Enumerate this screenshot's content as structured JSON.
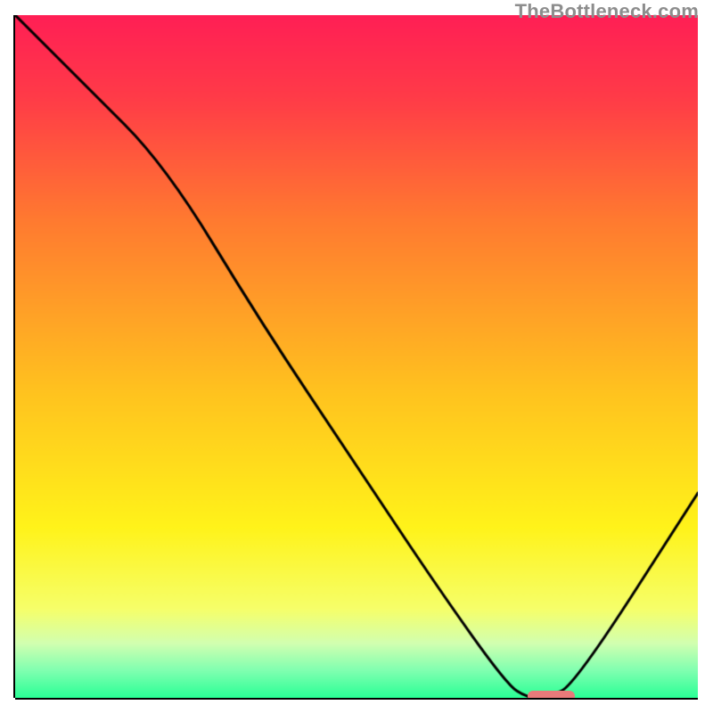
{
  "watermark": "TheBottleneck.com",
  "chart_data": {
    "type": "line",
    "title": "",
    "xlabel": "",
    "ylabel": "",
    "xlim": [
      0,
      100
    ],
    "ylim": [
      0,
      100
    ],
    "background": {
      "type": "vertical-gradient",
      "stops": [
        {
          "pos": 0.0,
          "color": "#ff1f55"
        },
        {
          "pos": 0.12,
          "color": "#ff3b48"
        },
        {
          "pos": 0.3,
          "color": "#ff7a30"
        },
        {
          "pos": 0.55,
          "color": "#ffc21f"
        },
        {
          "pos": 0.75,
          "color": "#fff31a"
        },
        {
          "pos": 0.87,
          "color": "#f6ff6a"
        },
        {
          "pos": 0.92,
          "color": "#d2ffb0"
        },
        {
          "pos": 0.96,
          "color": "#80ffb0"
        },
        {
          "pos": 1.0,
          "color": "#2aff96"
        }
      ]
    },
    "series": [
      {
        "name": "bottleneck-curve",
        "x": [
          0,
          10,
          22,
          36,
          50,
          62,
          72,
          75,
          78,
          82,
          100
        ],
        "y": [
          100,
          90,
          78,
          55,
          34,
          16,
          2,
          0,
          0,
          2,
          30
        ]
      }
    ],
    "marker": {
      "name": "optimal-range-marker",
      "x_start": 75,
      "x_end": 82,
      "y": 0,
      "color": "#e87a7a"
    },
    "axes_visible": true,
    "ticks_visible": false,
    "grid": false
  }
}
